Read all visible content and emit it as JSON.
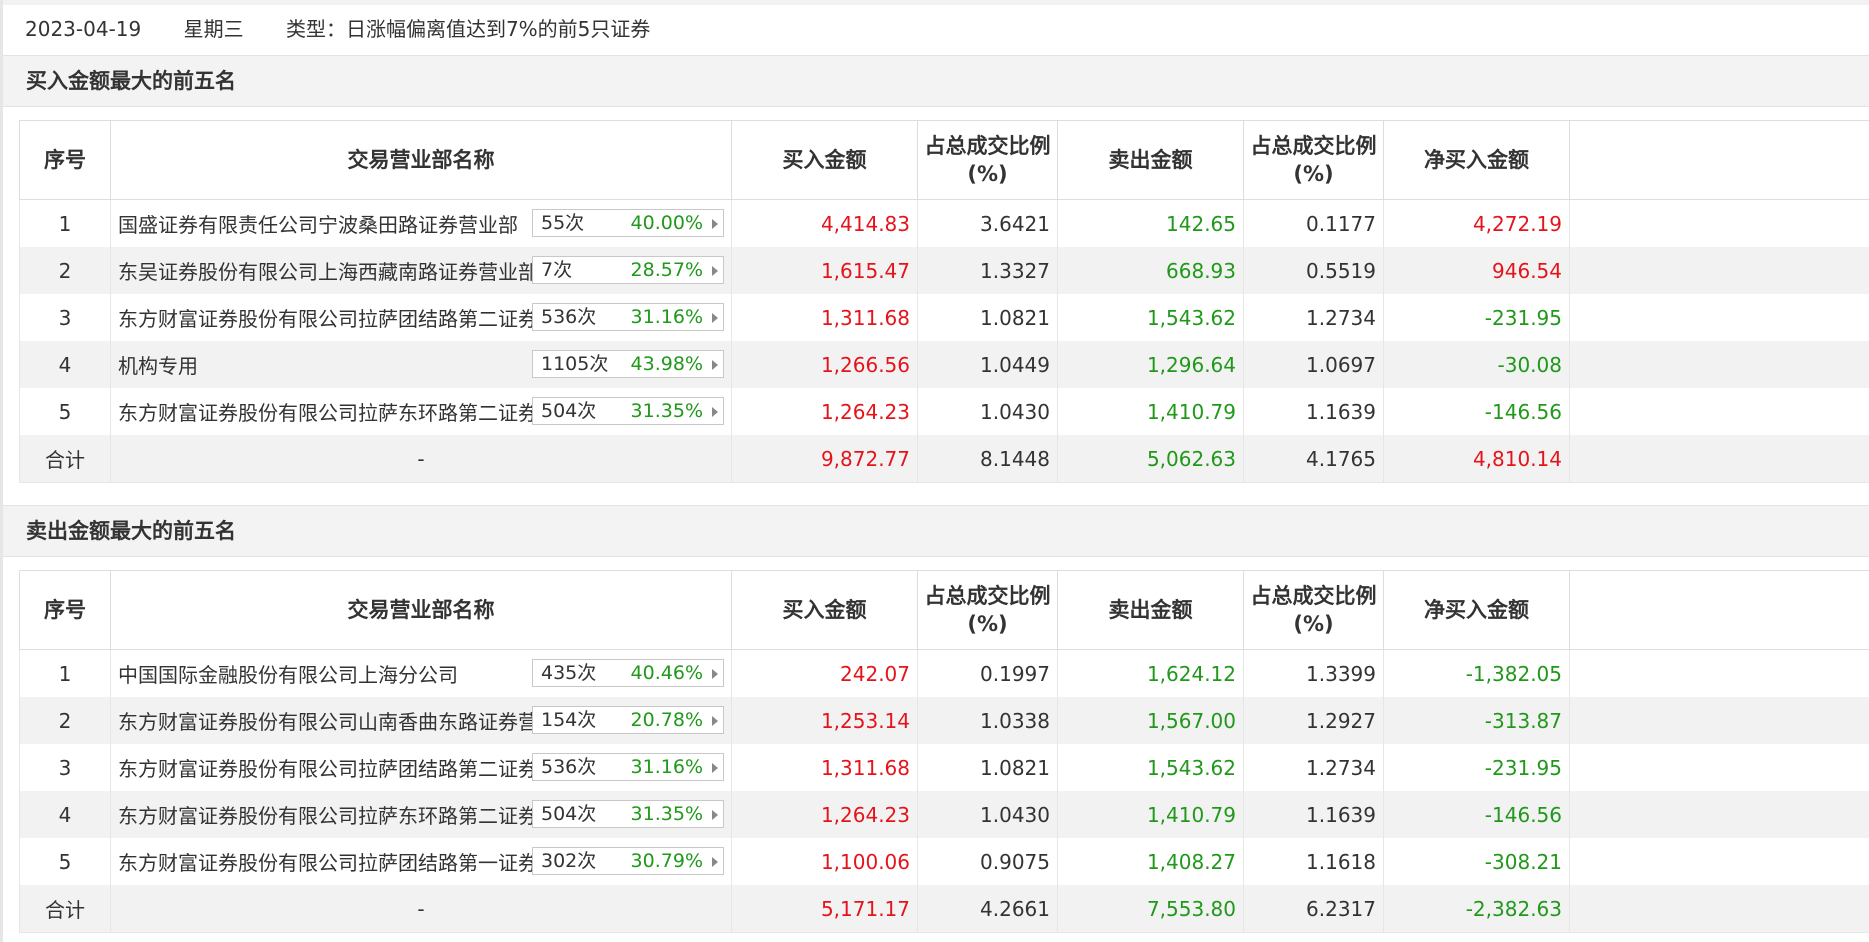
{
  "info": {
    "date": "2023-04-19",
    "weekday": "星期三",
    "type_text": "类型：日涨幅偏离值达到7%的前5只证券"
  },
  "columns": {
    "idx": "序号",
    "name": "交易营业部名称",
    "buy": "买入金额",
    "buy_pct_line1": "占总成交比例",
    "buy_pct_line2": "(%)",
    "sell": "卖出金额",
    "sell_pct_line1": "占总成交比例",
    "sell_pct_line2": "(%)",
    "net": "净买入金额"
  },
  "colors": {
    "red": "#e5141b",
    "green": "#20981a",
    "text": "#333333",
    "row_alt": "#f2f2f2",
    "section_bg": "#f3f3f3"
  },
  "buy_section": {
    "title": "买入金额最大的前五名",
    "rows": [
      {
        "idx": "1",
        "name": "国盛证券有限责任公司宁波桑田路证券营业部",
        "times": "55次",
        "pct": "40.00%",
        "buy": "4,414.83",
        "buy_pct": "3.6421",
        "sell": "142.65",
        "sell_pct": "0.1177",
        "net": "4,272.19",
        "net_color": "red"
      },
      {
        "idx": "2",
        "name": "东吴证券股份有限公司上海西藏南路证券营业部",
        "times": "7次",
        "pct": "28.57%",
        "buy": "1,615.47",
        "buy_pct": "1.3327",
        "sell": "668.93",
        "sell_pct": "0.5519",
        "net": "946.54",
        "net_color": "red"
      },
      {
        "idx": "3",
        "name": "东方财富证券股份有限公司拉萨团结路第二证券营业部",
        "times": "536次",
        "pct": "31.16%",
        "buy": "1,311.68",
        "buy_pct": "1.0821",
        "sell": "1,543.62",
        "sell_pct": "1.2734",
        "net": "-231.95",
        "net_color": "green"
      },
      {
        "idx": "4",
        "name": "机构专用",
        "times": "1105次",
        "pct": "43.98%",
        "buy": "1,266.56",
        "buy_pct": "1.0449",
        "sell": "1,296.64",
        "sell_pct": "1.0697",
        "net": "-30.08",
        "net_color": "green"
      },
      {
        "idx": "5",
        "name": "东方财富证券股份有限公司拉萨东环路第二证券营业部",
        "times": "504次",
        "pct": "31.35%",
        "buy": "1,264.23",
        "buy_pct": "1.0430",
        "sell": "1,410.79",
        "sell_pct": "1.1639",
        "net": "-146.56",
        "net_color": "green"
      }
    ],
    "total": {
      "label": "合计",
      "name": "-",
      "buy": "9,872.77",
      "buy_pct": "8.1448",
      "sell": "5,062.63",
      "sell_pct": "4.1765",
      "net": "4,810.14",
      "net_color": "red"
    }
  },
  "sell_section": {
    "title": "卖出金额最大的前五名",
    "rows": [
      {
        "idx": "1",
        "name": "中国国际金融股份有限公司上海分公司",
        "times": "435次",
        "pct": "40.46%",
        "buy": "242.07",
        "buy_pct": "0.1997",
        "sell": "1,624.12",
        "sell_pct": "1.3399",
        "net": "-1,382.05",
        "net_color": "green"
      },
      {
        "idx": "2",
        "name": "东方财富证券股份有限公司山南香曲东路证券营业部",
        "times": "154次",
        "pct": "20.78%",
        "buy": "1,253.14",
        "buy_pct": "1.0338",
        "sell": "1,567.00",
        "sell_pct": "1.2927",
        "net": "-313.87",
        "net_color": "green"
      },
      {
        "idx": "3",
        "name": "东方财富证券股份有限公司拉萨团结路第二证券营业部",
        "times": "536次",
        "pct": "31.16%",
        "buy": "1,311.68",
        "buy_pct": "1.0821",
        "sell": "1,543.62",
        "sell_pct": "1.2734",
        "net": "-231.95",
        "net_color": "green"
      },
      {
        "idx": "4",
        "name": "东方财富证券股份有限公司拉萨东环路第二证券营业部",
        "times": "504次",
        "pct": "31.35%",
        "buy": "1,264.23",
        "buy_pct": "1.0430",
        "sell": "1,410.79",
        "sell_pct": "1.1639",
        "net": "-146.56",
        "net_color": "green"
      },
      {
        "idx": "5",
        "name": "东方财富证券股份有限公司拉萨团结路第一证券营业部",
        "times": "302次",
        "pct": "30.79%",
        "buy": "1,100.06",
        "buy_pct": "0.9075",
        "sell": "1,408.27",
        "sell_pct": "1.1618",
        "net": "-308.21",
        "net_color": "green"
      }
    ],
    "total": {
      "label": "合计",
      "name": "-",
      "buy": "5,171.17",
      "buy_pct": "4.2661",
      "sell": "7,553.80",
      "sell_pct": "6.2317",
      "net": "-2,382.63",
      "net_color": "green"
    }
  }
}
